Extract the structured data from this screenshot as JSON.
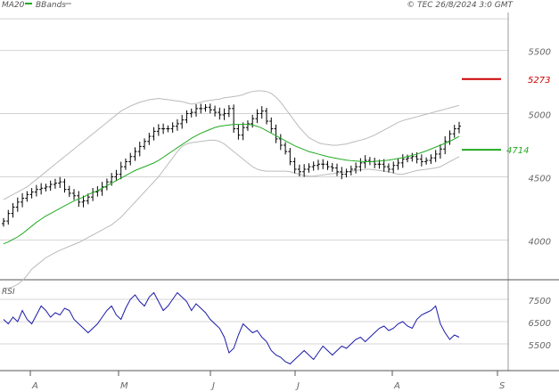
{
  "header": {
    "ma_label": "MA20",
    "bb_label": "BBands",
    "source": "© TEC 26/8/2024 3:0 GMT"
  },
  "colors": {
    "ma": "#22aa22",
    "bbands": "#bbbbbb",
    "price": "#000000",
    "rsi": "#1a1aaa",
    "resistance": "#cc0000",
    "support": "#22aa22",
    "grid": "#d4d4d4",
    "frame": "#999999"
  },
  "chart_data": [
    {
      "type": "ohlc",
      "panel": "price",
      "x_labels": [
        "A",
        "M",
        "J",
        "J",
        "A",
        "S"
      ],
      "y_ticks": [
        4000,
        4500,
        5000,
        5500
      ],
      "y_tick_labels": [
        "4000",
        "4500",
        "5000",
        "5500"
      ],
      "ylim": [
        3700,
        5800
      ],
      "grid": true,
      "series": [
        {
          "name": "MA20",
          "values": [
            3970,
            3985,
            4005,
            4025,
            4050,
            4080,
            4110,
            4140,
            4165,
            4190,
            4210,
            4230,
            4250,
            4270,
            4290,
            4310,
            4325,
            4340,
            4360,
            4375,
            4390,
            4410,
            4430,
            4450,
            4470,
            4490,
            4510,
            4530,
            4550,
            4565,
            4580,
            4595,
            4610,
            4630,
            4655,
            4680,
            4705,
            4730,
            4755,
            4780,
            4805,
            4825,
            4845,
            4860,
            4875,
            4890,
            4900,
            4905,
            4910,
            4915,
            4915,
            4915,
            4915,
            4910,
            4900,
            4885,
            4865,
            4845,
            4825,
            4805,
            4785,
            4765,
            4745,
            4730,
            4715,
            4700,
            4690,
            4680,
            4670,
            4660,
            4652,
            4645,
            4638,
            4632,
            4628,
            4625,
            4622,
            4620,
            4620,
            4622,
            4625,
            4628,
            4632,
            4638,
            4645,
            4652,
            4660,
            4670,
            4680,
            4692,
            4705,
            4720,
            4735,
            4750,
            4765,
            4780,
            4800,
            4820
          ]
        },
        {
          "name": "BBands upper",
          "values": [
            4320,
            4340,
            4360,
            4380,
            4400,
            4420,
            4450,
            4480,
            4510,
            4540,
            4570,
            4600,
            4630,
            4660,
            4690,
            4720,
            4750,
            4780,
            4810,
            4840,
            4870,
            4900,
            4930,
            4960,
            4990,
            5020,
            5040,
            5060,
            5075,
            5090,
            5100,
            5110,
            5115,
            5120,
            5115,
            5110,
            5105,
            5100,
            5095,
            5085,
            5075,
            5080,
            5090,
            5100,
            5105,
            5110,
            5115,
            5125,
            5130,
            5135,
            5140,
            5150,
            5165,
            5175,
            5180,
            5180,
            5175,
            5160,
            5130,
            5090,
            5040,
            4990,
            4940,
            4890,
            4850,
            4810,
            4790,
            4770,
            4760,
            4755,
            4750,
            4750,
            4755,
            4760,
            4770,
            4780,
            4790,
            4800,
            4815,
            4830,
            4850,
            4870,
            4890,
            4910,
            4930,
            4945,
            4955,
            4965,
            4975,
            4985,
            4995,
            5005,
            5015,
            5025,
            5035,
            5045,
            5055,
            5065
          ]
        },
        {
          "name": "BBands lower",
          "values": [
            3620,
            3620,
            3630,
            3650,
            3680,
            3720,
            3770,
            3800,
            3830,
            3860,
            3880,
            3900,
            3920,
            3935,
            3950,
            3965,
            3980,
            4000,
            4020,
            4040,
            4060,
            4080,
            4100,
            4120,
            4150,
            4180,
            4220,
            4260,
            4300,
            4340,
            4380,
            4420,
            4460,
            4500,
            4550,
            4600,
            4650,
            4700,
            4740,
            4760,
            4770,
            4775,
            4780,
            4785,
            4790,
            4790,
            4780,
            4760,
            4730,
            4700,
            4670,
            4640,
            4610,
            4580,
            4560,
            4550,
            4545,
            4545,
            4545,
            4545,
            4545,
            4540,
            4530,
            4520,
            4510,
            4505,
            4505,
            4510,
            4515,
            4520,
            4525,
            4530,
            4535,
            4540,
            4545,
            4550,
            4555,
            4560,
            4560,
            4555,
            4550,
            4545,
            4540,
            4530,
            4520,
            4520,
            4530,
            4540,
            4550,
            4555,
            4560,
            4565,
            4570,
            4580,
            4600,
            4620,
            4640,
            4660
          ]
        },
        {
          "name": "Close",
          "values": [
            4150,
            4210,
            4260,
            4300,
            4330,
            4360,
            4380,
            4400,
            4410,
            4420,
            4440,
            4450,
            4460,
            4400,
            4370,
            4350,
            4300,
            4310,
            4340,
            4380,
            4390,
            4420,
            4460,
            4500,
            4520,
            4580,
            4620,
            4660,
            4700,
            4740,
            4780,
            4820,
            4860,
            4880,
            4880,
            4880,
            4900,
            4920,
            4950,
            5000,
            5010,
            5040,
            5040,
            5050,
            5030,
            5010,
            4990,
            5000,
            5040,
            4880,
            4830,
            4890,
            4920,
            4960,
            5000,
            5020,
            4940,
            4880,
            4800,
            4750,
            4700,
            4620,
            4560,
            4540,
            4560,
            4580,
            4590,
            4600,
            4600,
            4580,
            4570,
            4540,
            4520,
            4540,
            4560,
            4580,
            4610,
            4630,
            4620,
            4600,
            4600,
            4580,
            4560,
            4590,
            4610,
            4640,
            4650,
            4660,
            4640,
            4620,
            4630,
            4650,
            4680,
            4720,
            4780,
            4840,
            4880,
            4900
          ]
        }
      ],
      "levels": [
        {
          "name": "resistance",
          "value": 5273,
          "label": "5273"
        },
        {
          "name": "support",
          "value": 4714,
          "label": "4714"
        }
      ]
    },
    {
      "type": "line",
      "panel": "rsi",
      "title": "RSI",
      "y_ticks": [
        55,
        65,
        75
      ],
      "y_tick_labels": [
        "5500",
        "6500",
        "7500"
      ],
      "ylim": [
        43,
        83
      ],
      "series": [
        {
          "name": "RSI",
          "values": [
            66,
            64,
            67,
            65,
            70,
            66,
            64,
            68,
            72,
            70,
            67,
            69,
            68,
            71,
            70,
            66,
            64,
            62,
            60,
            62,
            64,
            67,
            70,
            72,
            68,
            66,
            71,
            75,
            77,
            74,
            72,
            76,
            78,
            74,
            70,
            72,
            75,
            78,
            76,
            74,
            70,
            73,
            71,
            69,
            66,
            64,
            62,
            58,
            51,
            53,
            59,
            64,
            62,
            60,
            61,
            58,
            56,
            52,
            50,
            49,
            47,
            46,
            48,
            50,
            52,
            50,
            48,
            51,
            54,
            52,
            50,
            52,
            54,
            53,
            55,
            57,
            58,
            56,
            58,
            60,
            62,
            63,
            61,
            62,
            64,
            65,
            63,
            62,
            66,
            68,
            69,
            70,
            72,
            64,
            60,
            57,
            59,
            58
          ]
        }
      ]
    }
  ]
}
